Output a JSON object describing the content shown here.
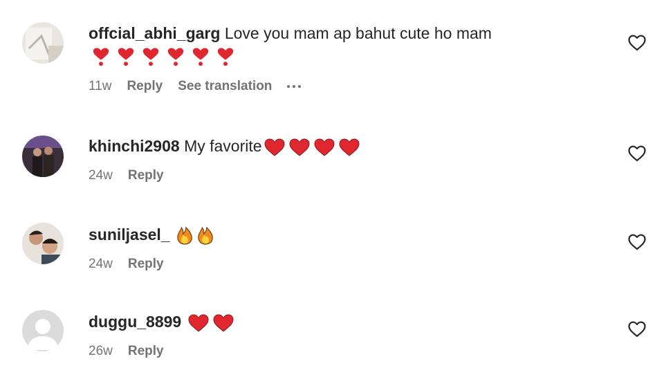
{
  "comments": [
    {
      "username": "offcial_abhi_garg",
      "text": "Love you mam ap bahut cute ho mam",
      "emoji": "heart-exclamation",
      "emoji_count": 6,
      "time": "11w",
      "reply_label": "Reply",
      "translate_label": "See translation",
      "has_more": true
    },
    {
      "username": "khinchi2908",
      "text": "My favorite",
      "emoji": "red-heart",
      "emoji_count": 4,
      "time": "24w",
      "reply_label": "Reply"
    },
    {
      "username": "suniljasel_",
      "text": "",
      "emoji": "fire",
      "emoji_count": 2,
      "time": "24w",
      "reply_label": "Reply"
    },
    {
      "username": "duggu_8899",
      "text": "",
      "emoji": "red-heart",
      "emoji_count": 2,
      "time": "26w",
      "reply_label": "Reply"
    }
  ],
  "icons": {
    "like": "heart-outline-icon",
    "more": "more-options-icon"
  },
  "colors": {
    "heart": "#e0262e",
    "meta_text": "#737373",
    "username": "#262626"
  }
}
